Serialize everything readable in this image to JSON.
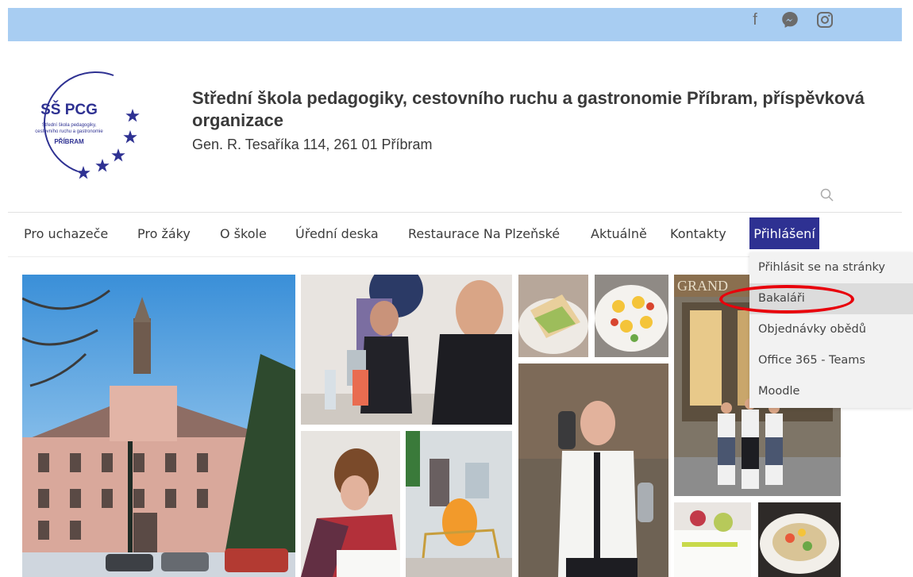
{
  "social": {
    "facebook_glyph": "f",
    "icons": [
      "facebook-icon",
      "messenger-icon",
      "instagram-icon"
    ]
  },
  "logo": {
    "abbr": "SŠ PCG",
    "line1": "Střední škola pedagogiky,",
    "line2": "cestovního ruchu a gastronomie",
    "city": "PŘÍBRAM"
  },
  "header": {
    "title": "Střední škola pedagogiky, cestovního ruchu a gastronomie Příbram, příspěvková organizace",
    "address": "Gen. R. Tesaříka 114, 261 01 Příbram"
  },
  "nav": {
    "items": [
      "Pro uchazeče",
      "Pro žáky",
      "O škole",
      "Úřední deska",
      "Restaurace Na Plzeňské",
      "Aktuálně",
      "Kontakty",
      "Přihlášení"
    ]
  },
  "dropdown": {
    "items": [
      "Přihlásit se na stránky",
      "Bakaláři",
      "Objednávky obědů",
      "Office 365 - Teams",
      "Moodle"
    ],
    "highlighted": "Bakaláři"
  },
  "gallery": {
    "grande_sign": "GRAND"
  },
  "colors": {
    "topbar": "#a8cdf2",
    "brand": "#2e3192",
    "annotation": "#e8000b"
  }
}
